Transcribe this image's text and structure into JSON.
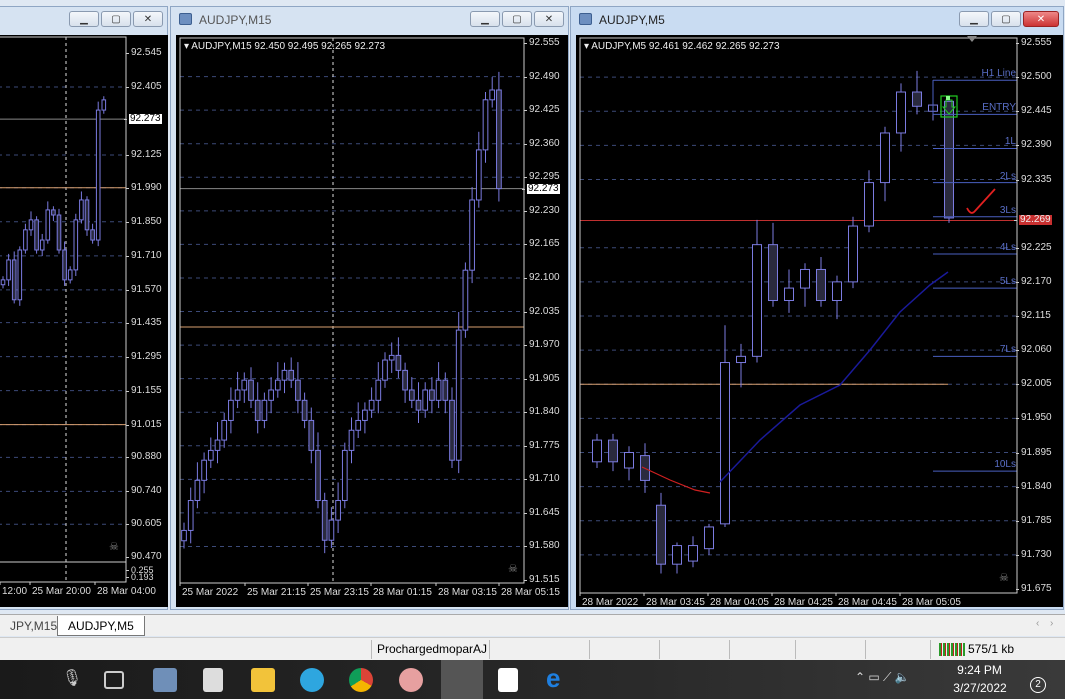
{
  "windows": {
    "left": {
      "title": "",
      "ticks": [
        "92.545",
        "92.405",
        "92.125",
        "91.990",
        "91.850",
        "91.710",
        "91.570",
        "91.435",
        "91.295",
        "91.155",
        "91.015",
        "90.880",
        "90.740",
        "90.605",
        "90.470"
      ],
      "current_price": "92.273",
      "sub_ticks": [
        "0.255",
        "0.193"
      ],
      "times": [
        "12:00",
        "25 Mar 20:00",
        "28 Mar 04:00"
      ],
      "closes": [
        91.611,
        91.693,
        91.529,
        91.734,
        91.817,
        91.858,
        91.734,
        91.775,
        91.899,
        91.878,
        91.734,
        91.611,
        91.652,
        91.858,
        91.94,
        91.817,
        91.775,
        92.31,
        92.352
      ],
      "orange_level": 91.015,
      "orange_level_top": 91.99
    },
    "m15": {
      "title": "AUDJPY,M15",
      "header": "AUDJPY,M15  92.450 92.495 92.265 92.273",
      "ticks": [
        "92.555",
        "92.490",
        "92.425",
        "92.360",
        "92.295",
        "92.230",
        "92.165",
        "92.100",
        "92.035",
        "91.970",
        "91.905",
        "91.840",
        "91.775",
        "91.710",
        "91.645",
        "91.580",
        "91.515"
      ],
      "current_price": "92.273",
      "times": [
        "25 Mar 2022",
        "25 Mar 21:15",
        "25 Mar 23:15",
        "28 Mar 01:15",
        "28 Mar 03:15",
        "28 Mar 05:15"
      ],
      "closes": [
        91.611,
        91.669,
        91.708,
        91.747,
        91.766,
        91.786,
        91.824,
        91.863,
        91.883,
        91.902,
        91.863,
        91.824,
        91.863,
        91.883,
        91.902,
        91.921,
        91.902,
        91.863,
        91.824,
        91.766,
        91.669,
        91.592,
        91.631,
        91.669,
        91.766,
        91.805,
        91.824,
        91.844,
        91.863,
        91.902,
        91.941,
        91.95,
        91.921,
        91.883,
        91.863,
        91.844,
        91.883,
        91.863,
        91.902,
        91.863,
        91.747,
        91.999,
        92.115,
        92.251,
        92.348,
        92.445,
        92.464,
        92.273
      ],
      "orange_level": 92.005
    },
    "m5": {
      "title": "AUDJPY,M5",
      "header": "AUDJPY,M5  92.461 92.462 92.265 92.273",
      "ticks": [
        "92.555",
        "92.500",
        "92.445",
        "92.390",
        "92.335",
        "92.225",
        "92.170",
        "92.115",
        "92.060",
        "92.005",
        "91.950",
        "91.895",
        "91.840",
        "91.785",
        "91.730",
        "91.675"
      ],
      "current_price": "92.269",
      "times": [
        "28 Mar 2022",
        "28 Mar 03:45",
        "28 Mar 04:05",
        "28 Mar 04:25",
        "28 Mar 04:45",
        "28 Mar 05:05"
      ],
      "levels": [
        {
          "label": "H1 Line",
          "price": 92.495
        },
        {
          "label": "ENTRY",
          "price": 92.44
        },
        {
          "label": "1L",
          "price": 92.385
        },
        {
          "label": "2Ls",
          "price": 92.33
        },
        {
          "label": "3Ls",
          "price": 92.275
        },
        {
          "label": "4Ls",
          "price": 92.215
        },
        {
          "label": "5Ls",
          "price": 92.16
        },
        {
          "label": "7Ls",
          "price": 92.05
        },
        {
          "label": "10Ls",
          "price": 91.865
        }
      ],
      "candles": [
        [
          91.88,
          91.925,
          91.87,
          91.915
        ],
        [
          91.915,
          91.925,
          91.865,
          91.88
        ],
        [
          91.87,
          91.905,
          91.85,
          91.895
        ],
        [
          91.89,
          91.91,
          91.83,
          91.85
        ],
        [
          91.81,
          91.83,
          91.7,
          91.715
        ],
        [
          91.715,
          91.75,
          91.7,
          91.745
        ],
        [
          91.72,
          91.76,
          91.71,
          91.745
        ],
        [
          91.74,
          91.78,
          91.73,
          91.775
        ],
        [
          91.78,
          92.1,
          91.775,
          92.04
        ],
        [
          92.04,
          92.07,
          92.0,
          92.05
        ],
        [
          92.05,
          92.27,
          92.04,
          92.23
        ],
        [
          92.23,
          92.265,
          92.13,
          92.14
        ],
        [
          92.14,
          92.19,
          92.12,
          92.16
        ],
        [
          92.16,
          92.2,
          92.13,
          92.19
        ],
        [
          92.19,
          92.21,
          92.13,
          92.14
        ],
        [
          92.14,
          92.18,
          92.11,
          92.17
        ],
        [
          92.17,
          92.275,
          92.16,
          92.26
        ],
        [
          92.26,
          92.35,
          92.25,
          92.33
        ],
        [
          92.33,
          92.42,
          92.3,
          92.41
        ],
        [
          92.41,
          92.49,
          92.38,
          92.476
        ],
        [
          92.476,
          92.51,
          92.44,
          92.453
        ],
        [
          92.445,
          92.495,
          92.43,
          92.455
        ],
        [
          92.461,
          92.462,
          92.265,
          92.273
        ]
      ],
      "orange_level": 92.005
    }
  },
  "tabs": [
    "JPY,M15",
    "AUDJPY,M5"
  ],
  "status": {
    "profile": "ProchargedmoparAJ",
    "traffic": "575/1 kb"
  },
  "taskbar": {
    "time": "9:24 PM",
    "date": "3/27/2022",
    "notifications": "2"
  },
  "colors": {
    "candle": "#7b7be0",
    "grid": "#3c4a78",
    "ma_blue": "#1a1a9a",
    "ma_red": "#d02020",
    "orange": "#d9a070",
    "red_line": "#c03030",
    "level": "#4a5fc0",
    "entry_box": "#22cc22"
  }
}
